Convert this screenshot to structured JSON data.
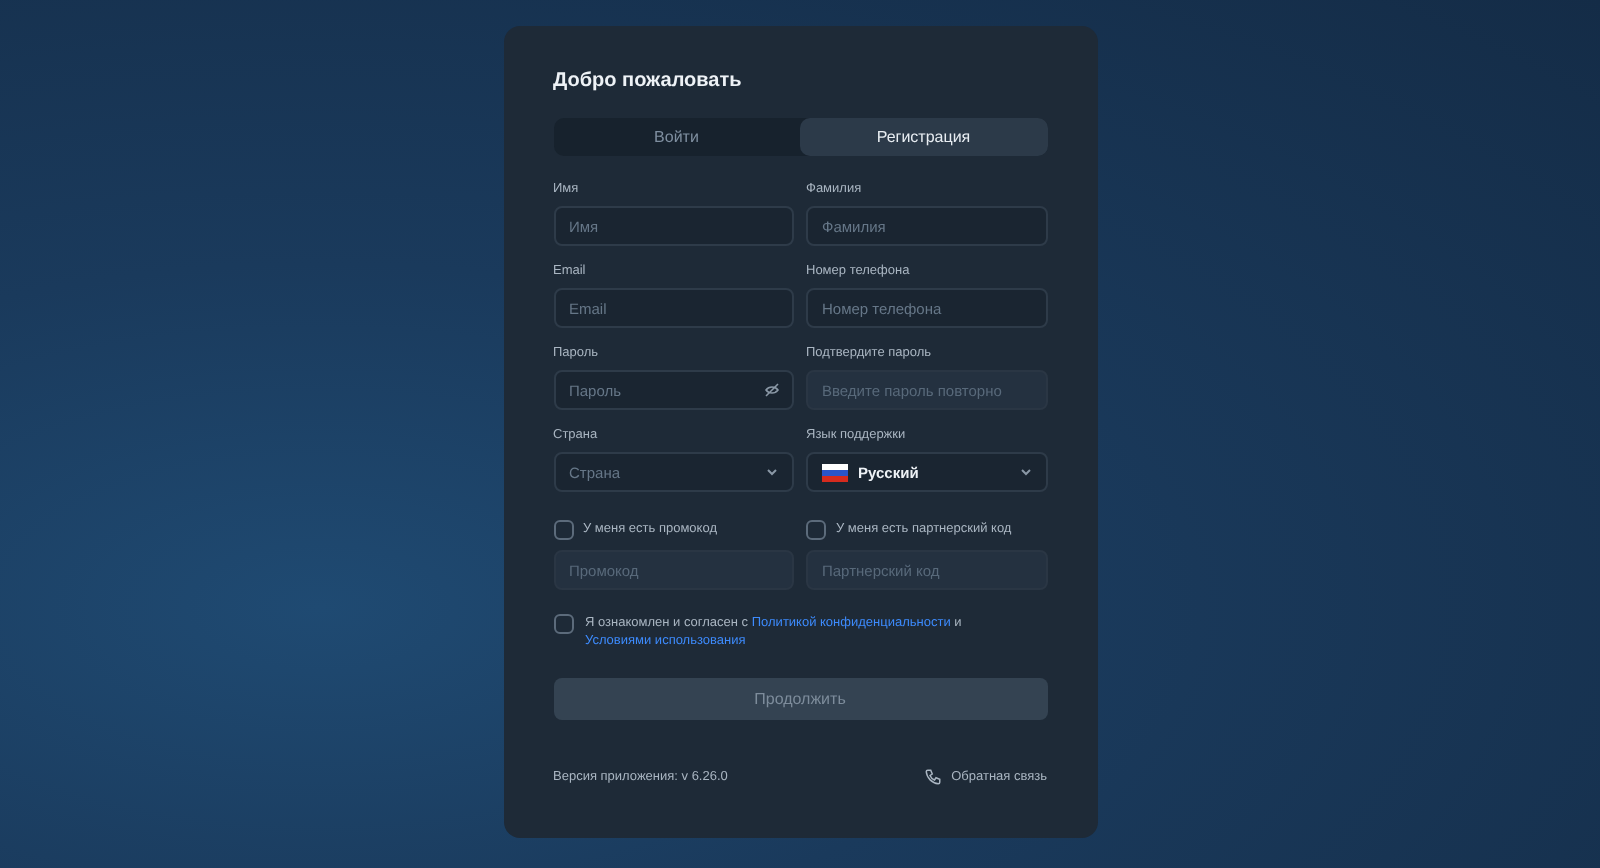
{
  "card": {
    "title": "Добро пожаловать"
  },
  "tabs": [
    {
      "label": "Войти",
      "selected": false
    },
    {
      "label": "Регистрация",
      "selected": true
    }
  ],
  "fields": [
    {
      "kind": "text",
      "label": "Имя",
      "placeholder": "Имя",
      "disabled": false
    },
    {
      "kind": "text",
      "label": "Фамилия",
      "placeholder": "Фамилия",
      "disabled": false
    },
    {
      "kind": "text",
      "label": "Email",
      "placeholder": "Email",
      "disabled": false
    },
    {
      "kind": "text",
      "label": "Номер телефона",
      "placeholder": "Номер телефона",
      "disabled": false
    },
    {
      "kind": "password",
      "label": "Пароль",
      "placeholder": "Пароль",
      "disabled": false
    },
    {
      "kind": "text",
      "label": "Подтвердите пароль",
      "placeholder": "Введите пароль повторно",
      "disabled": true
    },
    {
      "kind": "select",
      "label": "Страна",
      "placeholder": "Страна",
      "disabled": false
    },
    {
      "kind": "language",
      "label": "Язык поддержки",
      "value": "Русский",
      "disabled": false
    }
  ],
  "codes": [
    {
      "label": "У меня есть промокод",
      "checked": false,
      "placeholder": "Промокод",
      "disabled": true
    },
    {
      "label": "У меня есть партнерский код",
      "checked": false,
      "placeholder": "Партнерский код",
      "disabled": true
    }
  ],
  "consent": {
    "checked": false,
    "text": "Я ознакомлен и согласен с",
    "link1": "Политикой конфиденциальности",
    "joiner": "и",
    "link2": "Условиями использования"
  },
  "submit": {
    "label": "Продолжить",
    "disabled": true
  },
  "footer": {
    "version": "Версия приложения: v 6.26.0",
    "feedback": "Обратная связь"
  }
}
